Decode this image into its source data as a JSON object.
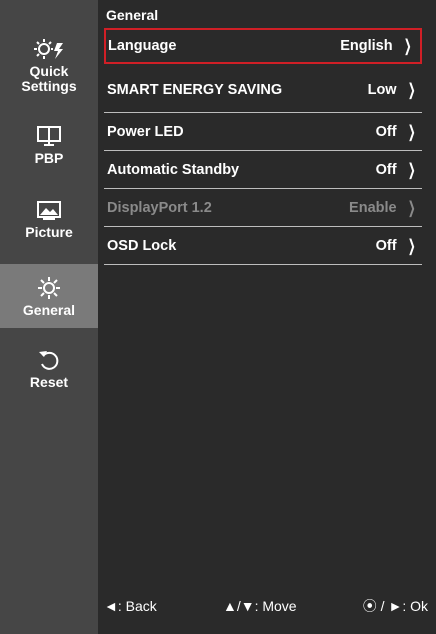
{
  "sidebar": {
    "items": [
      {
        "label_line1": "Quick",
        "label_line2": "Settings",
        "icon": "quick-settings-icon"
      },
      {
        "label_line1": "PBP",
        "label_line2": "",
        "icon": "pbp-icon"
      },
      {
        "label_line1": "Picture",
        "label_line2": "",
        "icon": "picture-icon"
      },
      {
        "label_line1": "General",
        "label_line2": "",
        "icon": "gear-icon",
        "active": true
      },
      {
        "label_line1": "Reset",
        "label_line2": "",
        "icon": "reset-icon"
      }
    ]
  },
  "main": {
    "title": "General",
    "rows": [
      {
        "label": "Language",
        "value": "English",
        "selected": true
      },
      {
        "label": "SMART ENERGY SAVING",
        "value": "Low"
      },
      {
        "label": "Power LED",
        "value": "Off"
      },
      {
        "label": "Automatic Standby",
        "value": "Off"
      },
      {
        "label": "DisplayPort 1.2",
        "value": "Enable",
        "disabled": true
      },
      {
        "label": "OSD Lock",
        "value": "Off"
      }
    ],
    "chevron": "❭"
  },
  "footer": {
    "back": "◄: Back",
    "move": "▲/▼: Move",
    "ok": "⦿ / ►: Ok"
  },
  "colors": {
    "sidebar_bg": "#464646",
    "active_bg": "#7a7a7a",
    "main_bg": "#2a2a2a",
    "selection_border": "#d01f26"
  }
}
